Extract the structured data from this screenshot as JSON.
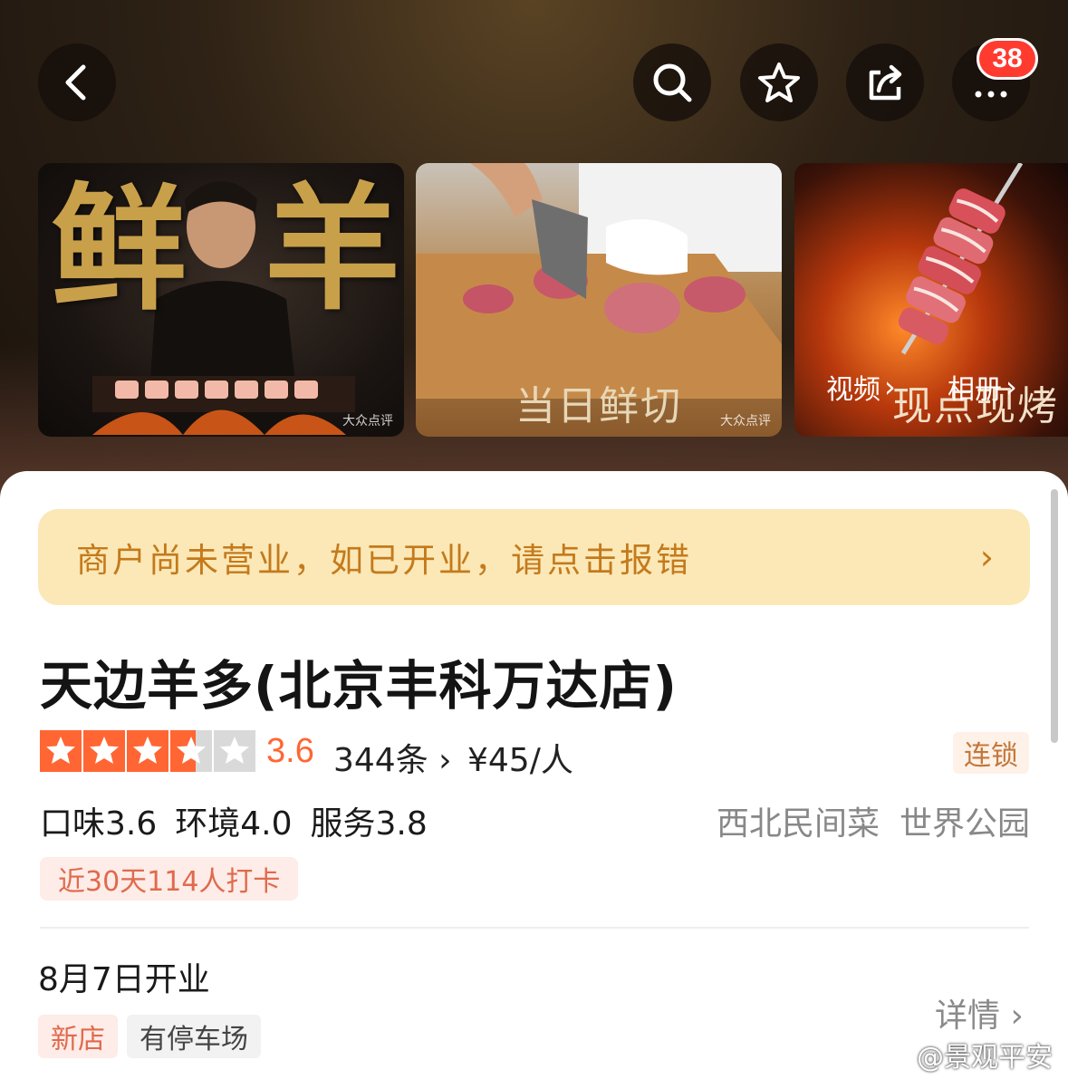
{
  "nav": {
    "back_icon": "chevron-left-icon",
    "search_icon": "search-icon",
    "favorite_icon": "star-icon",
    "share_icon": "share-icon",
    "more_icon": "more-dots-icon",
    "more_badge": "38"
  },
  "photos": {
    "photo1_chars": [
      "鲜",
      "羊"
    ],
    "photo1_watermark": "大众点评",
    "photo2_caption": "当日鲜切",
    "photo2_watermark": "大众点评",
    "photo3_caption": "现点现烤",
    "video_link": "视频",
    "album_link": "相册"
  },
  "notice": {
    "text": "商户尚未营业，如已开业，请点击报错"
  },
  "shop": {
    "name": "天边羊多(北京丰科万达店)",
    "rating_stars": 3.6,
    "rating": "3.6",
    "review_count": "344条",
    "price": "¥45/人",
    "chain_tag": "连锁",
    "taste": "口味3.6",
    "environment": "环境4.0",
    "service": "服务3.8",
    "cuisine": "西北民间菜",
    "area": "世界公园",
    "checkin": "近30天114人打卡",
    "opening": "8月7日开业",
    "details": "详情",
    "tags": [
      "新店",
      "有停车场"
    ]
  },
  "watermark": {
    "text": "@景观平安"
  },
  "colors": {
    "accent": "#ff6633",
    "notice_bg": "#fbe8b6",
    "notice_text": "#c47a1c",
    "badge": "#ff3b30"
  }
}
